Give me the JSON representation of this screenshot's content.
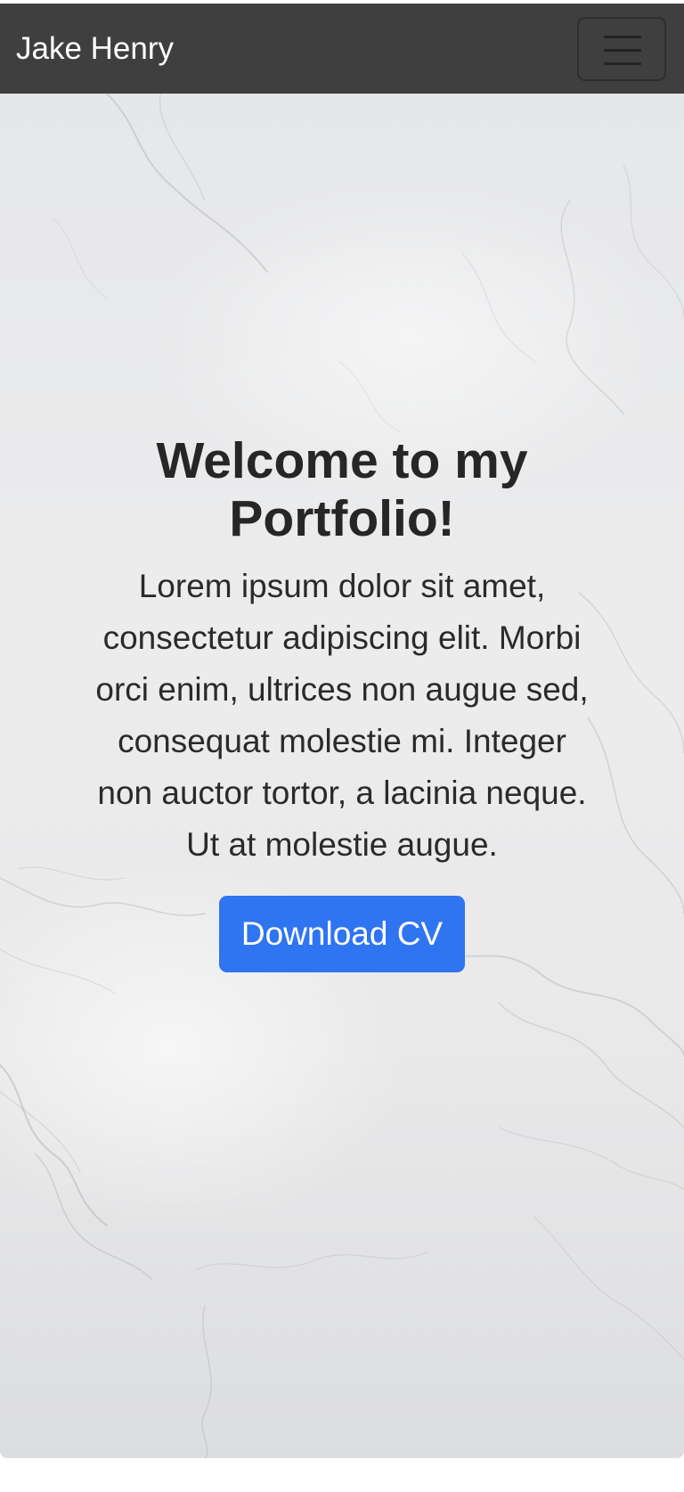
{
  "navbar": {
    "brand": "Jake Henry",
    "toggle_icon": "hamburger-menu-icon"
  },
  "hero": {
    "title": "Welcome to my Portfolio!",
    "text": "Lorem ipsum dolor sit amet, consectetur adipiscing elit. Morbi orci enim, ultrices non augue sed, consequat molestie mi. Integer non auctor tortor, a lacinia neque. Ut at molestie augue.",
    "button_label": "Download CV"
  },
  "colors": {
    "navbar_background": "#3f3f3f",
    "button_background": "#2f74f1",
    "text": "#262626"
  }
}
